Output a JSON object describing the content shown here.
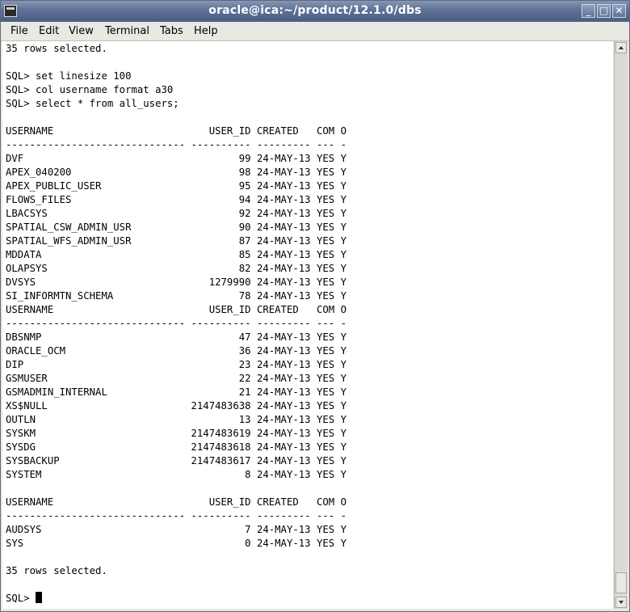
{
  "window": {
    "title": "oracle@ica:~/product/12.1.0/dbs"
  },
  "window_buttons": [
    "_",
    "□",
    "✕"
  ],
  "menu": [
    {
      "label": "File",
      "name": "menu-file"
    },
    {
      "label": "Edit",
      "name": "menu-edit"
    },
    {
      "label": "View",
      "name": "menu-view"
    },
    {
      "label": "Terminal",
      "name": "menu-terminal"
    },
    {
      "label": "Tabs",
      "name": "menu-tabs"
    },
    {
      "label": "Help",
      "name": "menu-help"
    }
  ],
  "terminal": {
    "lines": [
      "35 rows selected.",
      "",
      "SQL> set linesize 100",
      "SQL> col username format a30",
      "SQL> select * from all_users;",
      "",
      "USERNAME                          USER_ID CREATED   COM O",
      "------------------------------ ---------- --------- --- -",
      "DVF                                    99 24-MAY-13 YES Y",
      "APEX_040200                            98 24-MAY-13 YES Y",
      "APEX_PUBLIC_USER                       95 24-MAY-13 YES Y",
      "FLOWS_FILES                            94 24-MAY-13 YES Y",
      "LBACSYS                                92 24-MAY-13 YES Y",
      "SPATIAL_CSW_ADMIN_USR                  90 24-MAY-13 YES Y",
      "SPATIAL_WFS_ADMIN_USR                  87 24-MAY-13 YES Y",
      "MDDATA                                 85 24-MAY-13 YES Y",
      "OLAPSYS                                82 24-MAY-13 YES Y",
      "DVSYS                             1279990 24-MAY-13 YES Y",
      "SI_INFORMTN_SCHEMA                     78 24-MAY-13 YES Y",
      "USERNAME                          USER_ID CREATED   COM O",
      "------------------------------ ---------- --------- --- -",
      "DBSNMP                                 47 24-MAY-13 YES Y",
      "ORACLE_OCM                             36 24-MAY-13 YES Y",
      "DIP                                    23 24-MAY-13 YES Y",
      "GSMUSER                                22 24-MAY-13 YES Y",
      "GSMADMIN_INTERNAL                      21 24-MAY-13 YES Y",
      "XS$NULL                        2147483638 24-MAY-13 YES Y",
      "OUTLN                                  13 24-MAY-13 YES Y",
      "SYSKM                          2147483619 24-MAY-13 YES Y",
      "SYSDG                          2147483618 24-MAY-13 YES Y",
      "SYSBACKUP                      2147483617 24-MAY-13 YES Y",
      "SYSTEM                                  8 24-MAY-13 YES Y",
      "",
      "USERNAME                          USER_ID CREATED   COM O",
      "------------------------------ ---------- --------- --- -",
      "AUDSYS                                  7 24-MAY-13 YES Y",
      "SYS                                     0 24-MAY-13 YES Y",
      "",
      "35 rows selected.",
      ""
    ],
    "prompt": "SQL> "
  }
}
